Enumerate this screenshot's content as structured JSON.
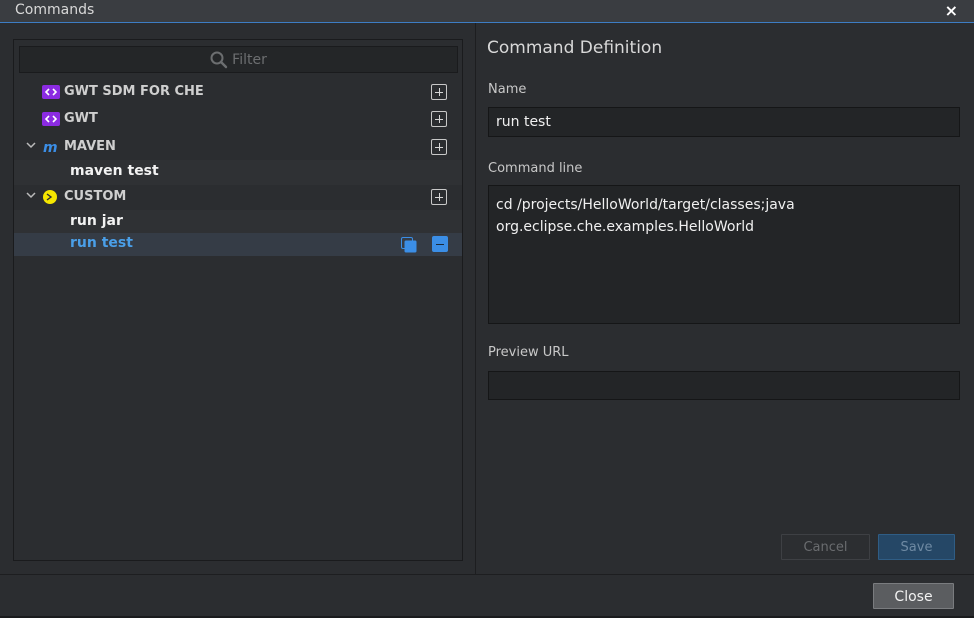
{
  "window": {
    "title": "Commands",
    "close_glyph": "×"
  },
  "filter": {
    "placeholder": "Filter",
    "icon": "search-icon"
  },
  "tree": {
    "groups": [
      {
        "label": "GWT SDM FOR CHE",
        "icon": "gwt-icon"
      },
      {
        "label": "GWT",
        "icon": "gwt-icon"
      },
      {
        "label": "MAVEN",
        "icon": "maven-icon",
        "expanded": true,
        "items": [
          "maven test"
        ]
      },
      {
        "label": "CUSTOM",
        "icon": "custom-icon",
        "expanded": true,
        "items": [
          "run jar",
          "run test"
        ]
      }
    ],
    "selected": "run test"
  },
  "editor": {
    "heading": "Command Definition",
    "name_label": "Name",
    "name_value": "run test",
    "cmd_label": "Command line",
    "cmd_value": "cd /projects/HelloWorld/target/classes;java\norg.eclipse.che.examples.HelloWorld",
    "url_label": "Preview URL",
    "url_value": "",
    "cancel_label": "Cancel",
    "save_label": "Save"
  },
  "footer": {
    "close_label": "Close"
  },
  "colors": {
    "accent": "#3b8ee6",
    "gwt": "#8b2be2",
    "maven": "#3b8ee6",
    "custom": "#f5e600"
  }
}
